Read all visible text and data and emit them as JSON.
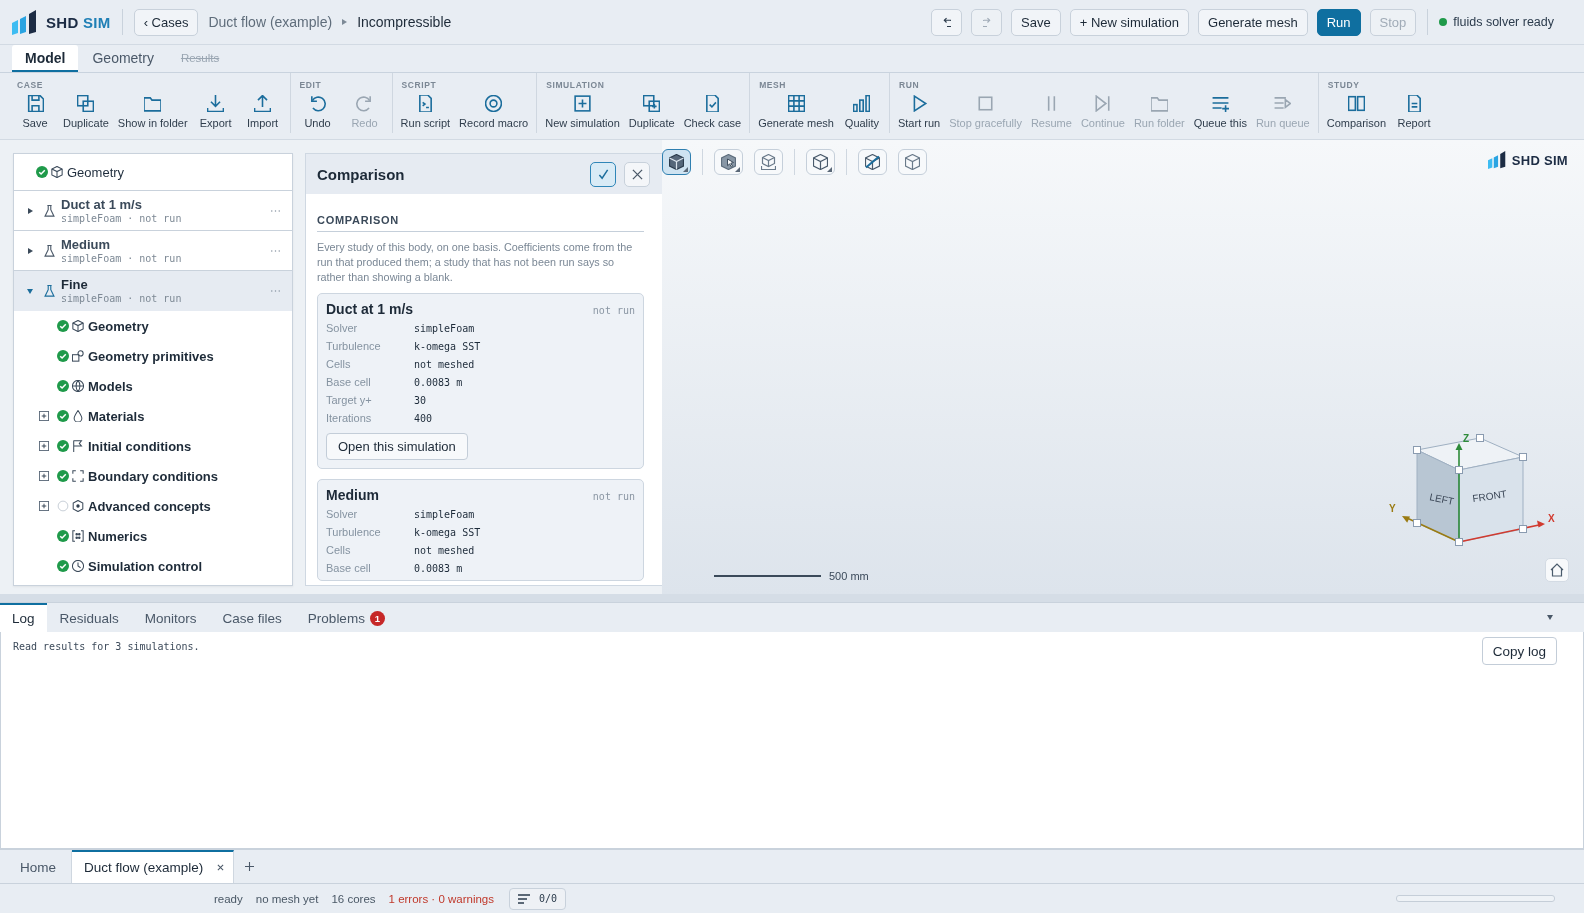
{
  "header": {
    "logo": {
      "name": "SHD",
      "suffix": "SIM"
    },
    "back_button": "‹ Cases",
    "breadcrumb": [
      "Duct flow (example)",
      "Incompressible"
    ],
    "buttons": [
      {
        "kind": "icon",
        "disabled": false
      },
      {
        "kind": "icon",
        "disabled": true
      },
      {
        "kind": "plain",
        "label": "Save",
        "disabled": false
      },
      {
        "kind": "plain",
        "label": "+ New simulation",
        "disabled": false
      },
      {
        "kind": "plain",
        "label": "Generate mesh",
        "disabled": false
      },
      {
        "kind": "primary",
        "label": "Run",
        "disabled": false
      },
      {
        "kind": "plain",
        "label": "Stop",
        "disabled": true
      }
    ],
    "solver_status": {
      "label": "fluids solver ready",
      "ready": true
    }
  },
  "tabs": [
    {
      "label": "Model",
      "selected": true,
      "disabled": false
    },
    {
      "label": "Geometry",
      "selected": false,
      "disabled": false
    },
    {
      "label": "Results",
      "selected": false,
      "disabled": true
    }
  ],
  "ribbon": [
    {
      "label": "CASE",
      "buttons": [
        {
          "label": "Save",
          "disabled": false
        },
        {
          "label": "Duplicate",
          "disabled": false
        },
        {
          "label": "Show in folder",
          "disabled": false
        },
        {
          "label": "Export",
          "disabled": false
        },
        {
          "label": "Import",
          "disabled": false
        }
      ]
    },
    {
      "label": "EDIT",
      "buttons": [
        {
          "label": "Undo",
          "disabled": false
        },
        {
          "label": "Redo",
          "disabled": true
        }
      ]
    },
    {
      "label": "SCRIPT",
      "buttons": [
        {
          "label": "Run script",
          "disabled": false
        },
        {
          "label": "Record macro",
          "disabled": false
        }
      ]
    },
    {
      "label": "SIMULATION",
      "buttons": [
        {
          "label": "New simulation",
          "disabled": false
        },
        {
          "label": "Duplicate",
          "disabled": false
        },
        {
          "label": "Check case",
          "disabled": false
        }
      ]
    },
    {
      "label": "MESH",
      "buttons": [
        {
          "label": "Generate mesh",
          "disabled": false
        },
        {
          "label": "Quality",
          "disabled": false
        }
      ]
    },
    {
      "label": "RUN",
      "buttons": [
        {
          "label": "Start run",
          "disabled": false
        },
        {
          "label": "Stop gracefully",
          "disabled": true
        },
        {
          "label": "Resume",
          "disabled": true
        },
        {
          "label": "Continue",
          "disabled": true
        },
        {
          "label": "Run folder",
          "disabled": true
        },
        {
          "label": "Queue this",
          "disabled": false
        },
        {
          "label": "Run queue",
          "disabled": true
        }
      ]
    },
    {
      "label": "STUDY",
      "buttons": [
        {
          "label": "Comparison",
          "disabled": false
        },
        {
          "label": "Report",
          "disabled": false
        }
      ]
    }
  ],
  "tree": {
    "root": {
      "label": "Geometry",
      "done": true
    },
    "studies": [
      {
        "name": "Duct at 1 m/s",
        "subtitle": "simpleFoam · not run",
        "expanded": false,
        "selected": false
      },
      {
        "name": "Medium",
        "subtitle": "simpleFoam · not run",
        "expanded": false,
        "selected": false
      },
      {
        "name": "Fine",
        "subtitle": "simpleFoam · not run",
        "expanded": true,
        "selected": true,
        "children": [
          {
            "label": "Geometry",
            "done": true,
            "expandable": false
          },
          {
            "label": "Geometry primitives",
            "done": true,
            "expandable": false
          },
          {
            "label": "Models",
            "done": true,
            "expandable": false
          },
          {
            "label": "Materials",
            "done": true,
            "expandable": true
          },
          {
            "label": "Initial conditions",
            "done": true,
            "expandable": true
          },
          {
            "label": "Boundary conditions",
            "done": true,
            "expandable": true
          },
          {
            "label": "Advanced concepts",
            "done": false,
            "expandable": true
          },
          {
            "label": "Numerics",
            "done": true,
            "expandable": false
          },
          {
            "label": "Simulation control",
            "done": true,
            "expandable": false
          }
        ]
      }
    ]
  },
  "comparison": {
    "title": "Comparison",
    "check_button": {
      "selected": true
    },
    "section": "COMPARISON",
    "description": "Every study of this body, on one basis. Coefficients come from the run that produced them; a study that has not been run says so rather than showing a blank.",
    "studies": [
      {
        "name": "Duct at 1 m/s",
        "status": "not run",
        "fields": [
          {
            "label": "Solver",
            "value": "simpleFoam"
          },
          {
            "label": "Turbulence",
            "value": "k-omega SST"
          },
          {
            "label": "Cells",
            "value": "not meshed"
          },
          {
            "label": "Base cell",
            "value": "0.0083 m"
          },
          {
            "label": "Target y+",
            "value": "30"
          },
          {
            "label": "Iterations",
            "value": "400"
          }
        ],
        "button": "Open this simulation"
      },
      {
        "name": "Medium",
        "status": "not run",
        "fields": [
          {
            "label": "Solver",
            "value": "simpleFoam"
          },
          {
            "label": "Turbulence",
            "value": "k-omega SST"
          },
          {
            "label": "Cells",
            "value": "not meshed"
          },
          {
            "label": "Base cell",
            "value": "0.0083 m"
          }
        ]
      }
    ]
  },
  "viewport": {
    "tool_groups": [
      {
        "tools": [
          {
            "selected": true,
            "menu": true
          }
        ]
      },
      {
        "tools": [
          {
            "selected": false,
            "menu": true
          },
          {
            "selected": false,
            "menu": false
          }
        ]
      },
      {
        "tools": [
          {
            "selected": false,
            "menu": true
          }
        ]
      },
      {
        "tools": [
          {
            "selected": false,
            "menu": false
          },
          {
            "selected": false,
            "menu": false
          }
        ]
      }
    ],
    "logo": "SHD SIM",
    "scale_bar": "500 mm",
    "axes": {
      "faces": [
        "LEFT",
        "FRONT"
      ],
      "x": "X",
      "y": "Y",
      "z": "Z"
    }
  },
  "bottom_panel": {
    "tabs": [
      {
        "label": "Log",
        "selected": true
      },
      {
        "label": "Residuals",
        "selected": false
      },
      {
        "label": "Monitors",
        "selected": false
      },
      {
        "label": "Case files",
        "selected": false
      },
      {
        "label": "Problems",
        "selected": false,
        "badge": "1"
      }
    ],
    "log": [
      "Read results for 3 simulations."
    ],
    "copy_button": "Copy log"
  },
  "documents": [
    {
      "label": "Home",
      "selected": false,
      "closable": false
    },
    {
      "label": "Duct flow (example)",
      "selected": true,
      "closable": true
    }
  ],
  "status_bar": {
    "items": [
      {
        "label": "ready",
        "alert": false
      },
      {
        "label": "no mesh yet",
        "alert": false
      },
      {
        "label": "16 cores",
        "alert": false
      },
      {
        "label": "1 errors · 0 warnings",
        "alert": true
      }
    ],
    "queue_button": "0/0"
  }
}
